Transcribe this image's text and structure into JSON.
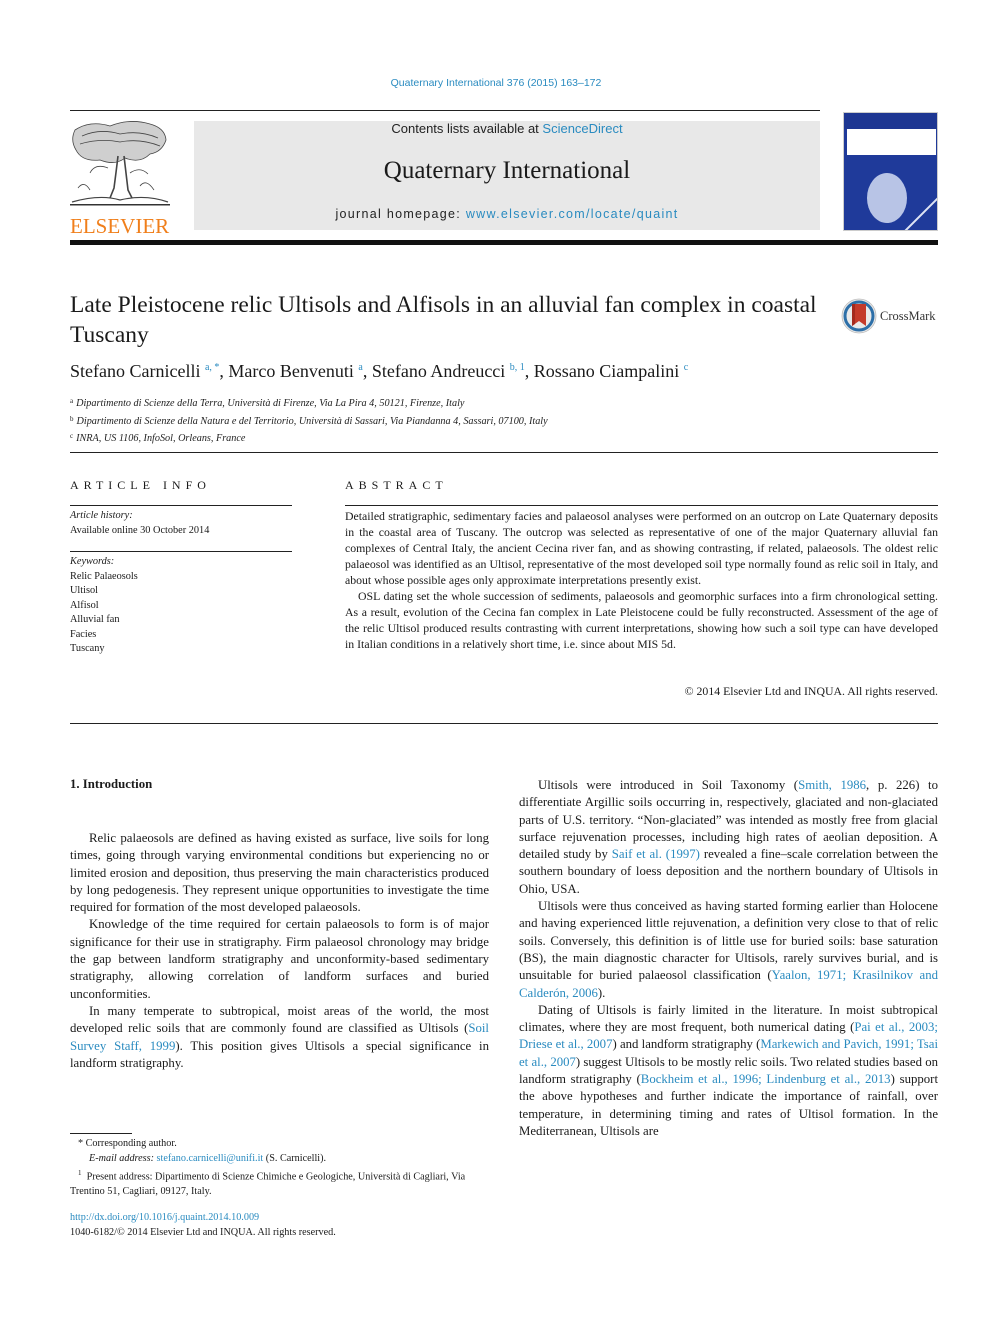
{
  "header": {
    "citation": "Quaternary International 376 (2015) 163–172",
    "contents_prefix": "Contents lists available at ",
    "contents_link": "ScienceDirect",
    "journal_name": "Quaternary International",
    "homepage_prefix": "journal homepage: ",
    "homepage_link": "www.elsevier.com/locate/quaint",
    "publisher_logo_text": "ELSEVIER",
    "crossmark_label": "CrossMark"
  },
  "article": {
    "title": "Late Pleistocene relic Ultisols and Alfisols in an alluvial fan complex in coastal Tuscany",
    "authors": [
      {
        "name": "Stefano Carnicelli",
        "sup": "a, *"
      },
      {
        "name": "Marco Benvenuti",
        "sup": "a"
      },
      {
        "name": "Stefano Andreucci",
        "sup": "b, 1"
      },
      {
        "name": "Rossano Ciampalini",
        "sup": "c"
      }
    ],
    "affiliations": [
      {
        "key": "a",
        "text": "Dipartimento di Scienze della Terra, Università di Firenze, Via La Pira 4, 50121, Firenze, Italy"
      },
      {
        "key": "b",
        "text": "Dipartimento di Scienze della Natura e del Territorio, Università di Sassari, Via Piandanna 4, Sassari, 07100, Italy"
      },
      {
        "key": "c",
        "text": "INRA, US 1106, InfoSol, Orleans, France"
      }
    ]
  },
  "article_info": {
    "heading": "ARTICLE INFO",
    "history_label": "Article history:",
    "history_value": "Available online 30 October 2014",
    "keywords_label": "Keywords:",
    "keywords": [
      "Relic Palaeosols",
      "Ultisol",
      "Alfisol",
      "Alluvial fan",
      "Facies",
      "Tuscany"
    ]
  },
  "abstract": {
    "heading": "ABSTRACT",
    "paragraphs": [
      "Detailed stratigraphic, sedimentary facies and palaeosol analyses were performed on an outcrop on Late Quaternary deposits in the coastal area of Tuscany. The outcrop was selected as representative of one of the major Quaternary alluvial fan complexes of Central Italy, the ancient Cecina river fan, and as showing contrasting, if related, palaeosols. The oldest relic palaeosol was identified as an Ultisol, representative of the most developed soil type normally found as relic soil in Italy, and about whose possible ages only approximate interpretations presently exist.",
      "OSL dating set the whole succession of sediments, palaeosols and geomorphic surfaces into a firm chronological setting. As a result, evolution of the Cecina fan complex in Late Pleistocene could be fully reconstructed. Assessment of the age of the relic Ultisol produced results contrasting with current interpretations, showing how such a soil type can have developed in Italian conditions in a relatively short time, i.e. since about MIS 5d."
    ],
    "copyright": "© 2014 Elsevier Ltd and INQUA. All rights reserved."
  },
  "body": {
    "section_heading": "1.  Introduction",
    "left_paragraphs": [
      {
        "parts": [
          {
            "t": "Relic palaeosols are defined as having existed as surface, live soils for long times, going through varying environmental conditions but experiencing no or limited erosion and deposition, thus preserving the main characteristics produced by long pedogenesis. They represent unique opportunities to investigate the time required for formation of the most developed palaeosols."
          }
        ]
      },
      {
        "parts": [
          {
            "t": "Knowledge of the time required for certain palaeosols to form is of major significance for their use in stratigraphy. Firm palaeosol chronology may bridge the gap between landform stratigraphy and unconformity-based sedimentary stratigraphy, allowing correlation of landform surfaces and buried unconformities."
          }
        ]
      },
      {
        "parts": [
          {
            "t": "In many temperate to subtropical, moist areas of the world, the most developed relic soils that are commonly found are classified as Ultisols ("
          },
          {
            "t": "Soil Survey Staff, 1999",
            "link": true
          },
          {
            "t": "). This position gives Ultisols a special significance in landform stratigraphy."
          }
        ]
      }
    ],
    "right_paragraphs": [
      {
        "parts": [
          {
            "t": "Ultisols were introduced in Soil Taxonomy ("
          },
          {
            "t": "Smith, 1986",
            "link": true
          },
          {
            "t": ", p. 226) to differentiate Argillic soils occurring in, respectively, glaciated and non-glaciated parts of U.S. territory. “Non-glaciated” was intended as mostly free from glacial surface rejuvenation processes, including high rates of aeolian deposition. A detailed study by "
          },
          {
            "t": "Saif et al. (1997)",
            "link": true
          },
          {
            "t": " revealed a fine–scale correlation between the southern boundary of loess deposition and the northern boundary of Ultisols in Ohio, USA."
          }
        ]
      },
      {
        "parts": [
          {
            "t": "Ultisols were thus conceived as having started forming earlier than Holocene and having experienced little rejuvenation, a definition very close to that of relic soils. Conversely, this definition is of little use for buried soils: base saturation (BS), the main diagnostic character for Ultisols, rarely survives burial, and is unsuitable for buried palaeosol classification ("
          },
          {
            "t": "Yaalon, 1971; Krasilnikov and Calderón, 2006",
            "link": true
          },
          {
            "t": ")."
          }
        ]
      },
      {
        "parts": [
          {
            "t": "Dating of Ultisols is fairly limited in the literature. In moist subtropical climates, where they are most frequent, both numerical dating ("
          },
          {
            "t": "Pai et al., 2003; Driese et al., 2007",
            "link": true
          },
          {
            "t": ") and landform stratigraphy ("
          },
          {
            "t": "Markewich and Pavich, 1991; Tsai et al., 2007",
            "link": true
          },
          {
            "t": ") suggest Ultisols to be mostly relic soils. Two related studies based on landform stratigraphy ("
          },
          {
            "t": "Bockheim et al., 1996; Lindenburg et al., 2013",
            "link": true
          },
          {
            "t": ") support the above hypotheses and further indicate the importance of rainfall, over temperature, in determining timing and rates of Ultisol formation. In the Mediterranean, Ultisols are"
          }
        ]
      }
    ]
  },
  "footnotes": {
    "corresponding": "* Corresponding author.",
    "email_label": "E-mail address: ",
    "email": "stefano.carnicelli@unifi.it",
    "email_suffix": " (S. Carnicelli).",
    "present_address": "Present address: Dipartimento di Scienze Chimiche e Geologiche, Università di Cagliari, Via Trentino 51, Cagliari, 09127, Italy.",
    "present_address_mark": "1",
    "doi": "http://dx.doi.org/10.1016/j.quaint.2014.10.009",
    "issn": "1040-6182/© 2014 Elsevier Ltd and INQUA. All rights reserved."
  },
  "colors": {
    "link": "#2a8bc0",
    "elsevier_orange": "#f07f1b",
    "masthead_bg": "#e8e8e8",
    "cover_blue": "#1f3a9a"
  }
}
